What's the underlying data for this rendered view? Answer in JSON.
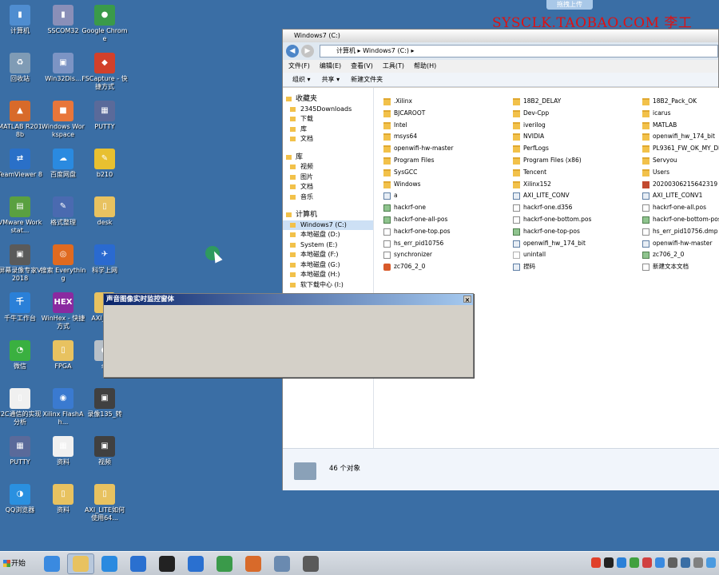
{
  "watermark": "SYSCLK.TAOBAO.COM 李工",
  "upload_button": "拖拽上传",
  "desktop_icons": [
    {
      "label": "计算机",
      "glyph": "▮",
      "color": "#4f8dd0"
    },
    {
      "label": "SSCOM32",
      "glyph": "▮",
      "color": "#8a8fb8"
    },
    {
      "label": "Google Chrome",
      "glyph": "●",
      "color": "#3a9a4a"
    },
    {
      "label": "回收站",
      "glyph": "♻",
      "color": "#7f9bb5"
    },
    {
      "label": "Win32Dis...",
      "glyph": "▣",
      "color": "#7c94c4"
    },
    {
      "label": "FSCapture - 快捷方式",
      "glyph": "◆",
      "color": "#d2402a"
    },
    {
      "label": "MATLAB R2018b",
      "glyph": "▲",
      "color": "#d86a2a"
    },
    {
      "label": "Windows Workspace",
      "glyph": "■",
      "color": "#e8763a"
    },
    {
      "label": "PUTTY",
      "glyph": "▦",
      "color": "#5a6a9a"
    },
    {
      "label": "TeamViewer 8",
      "glyph": "⇄",
      "color": "#2a70c8"
    },
    {
      "label": "百度网盘",
      "glyph": "☁",
      "color": "#2a8ae0"
    },
    {
      "label": "b210",
      "glyph": "✎",
      "color": "#e8c030"
    },
    {
      "label": "VMware Workstat...",
      "glyph": "▤",
      "color": "#5aa040"
    },
    {
      "label": "格式整理",
      "glyph": "✎",
      "color": "#4a6ab0"
    },
    {
      "label": "desk",
      "glyph": "▯",
      "color": "#e8c260"
    },
    {
      "label": "屏幕录像专家V2018",
      "glyph": "▣",
      "color": "#5a5a5a"
    },
    {
      "label": "搜索 Everything",
      "glyph": "◎",
      "color": "#e06a20"
    },
    {
      "label": "科学上网",
      "glyph": "✈",
      "color": "#2a6ad0"
    },
    {
      "label": "千牛工作台",
      "glyph": "千",
      "color": "#2a80d8"
    },
    {
      "label": "WinHex - 快捷方式",
      "glyph": "HEX",
      "color": "#8a2aa0"
    },
    {
      "label": "AXI_接口",
      "glyph": "▯",
      "color": "#e8c260"
    },
    {
      "label": "微信",
      "glyph": "◔",
      "color": "#3ab040"
    },
    {
      "label": "FPGA",
      "glyph": "▯",
      "color": "#e8c260"
    },
    {
      "label": "ss",
      "glyph": "●",
      "color": "#b8c0c8"
    },
    {
      "label": "I2C通信的实现分析",
      "glyph": "▯",
      "color": "#f0f0f0"
    },
    {
      "label": "Xilinx FlashAh...",
      "glyph": "◉",
      "color": "#3a7ad0"
    },
    {
      "label": "录像135_转",
      "glyph": "▣",
      "color": "#404040"
    },
    {
      "label": "PUTTY",
      "glyph": "▦",
      "color": "#5a6a9a"
    },
    {
      "label": "资料",
      "glyph": "▦",
      "color": "#f0f0f0"
    },
    {
      "label": "视频",
      "glyph": "▣",
      "color": "#404040"
    },
    {
      "label": "QQ浏览器",
      "glyph": "◑",
      "color": "#2a90e0"
    },
    {
      "label": "资料",
      "glyph": "▯",
      "color": "#e8c260"
    },
    {
      "label": "AXI_LITE如何使用64...",
      "glyph": "▯",
      "color": "#e8c260"
    }
  ],
  "explorer": {
    "title": "Windows7 (C:)",
    "address": "计算机 ▸ Windows7 (C:) ▸",
    "menu": [
      "文件(F)",
      "编辑(E)",
      "查看(V)",
      "工具(T)",
      "帮助(H)"
    ],
    "toolbar": [
      "组织 ▾",
      "共享 ▾",
      "新建文件夹"
    ],
    "nav": {
      "favorites": {
        "head": "收藏夹",
        "items": [
          "2345Downloads",
          "下载",
          "库",
          "文档"
        ]
      },
      "libraries": {
        "head": "库",
        "items": [
          "视频",
          "图片",
          "文档",
          "音乐"
        ]
      },
      "computer": {
        "head": "计算机",
        "items": [
          "Windows7 (C:)",
          "本地磁盘 (D:)",
          "System (E:)",
          "本地磁盘 (F:)",
          "本地磁盘 (G:)",
          "本地磁盘 (H:)",
          "软下载中心 (I:)"
        ]
      }
    },
    "files": [
      [
        {
          "name": ".Xilinx",
          "type": "folder"
        },
        {
          "name": "BJCAROOT",
          "type": "folder"
        },
        {
          "name": "Intel",
          "type": "folder"
        },
        {
          "name": "msys64",
          "type": "folder"
        },
        {
          "name": "openwifi-hw-master",
          "type": "folder"
        },
        {
          "name": "Program Files",
          "type": "folder"
        },
        {
          "name": "SysGCC",
          "type": "folder"
        },
        {
          "name": "Windows",
          "type": "folder"
        },
        {
          "name": "a",
          "type": "prog"
        },
        {
          "name": "hackrf-one",
          "type": "img"
        },
        {
          "name": "hackrf-one-all-pos",
          "type": "img"
        },
        {
          "name": "hackrf-one-top.pos",
          "type": "doc"
        },
        {
          "name": "hs_err_pid10756",
          "type": "doc"
        },
        {
          "name": "synchronizer",
          "type": "doc"
        },
        {
          "name": "zc706_2_0",
          "type": "app"
        },
        {
          "name": "AXI_LITE_CONV",
          "type": "folder"
        }
      ],
      [
        {
          "name": "18B2_DELAY",
          "type": "folder"
        },
        {
          "name": "Dev-Cpp",
          "type": "folder"
        },
        {
          "name": "iverilog",
          "type": "folder"
        },
        {
          "name": "NVIDIA",
          "type": "folder"
        },
        {
          "name": "PerfLogs",
          "type": "folder"
        },
        {
          "name": "Program Files (x86)",
          "type": "folder"
        },
        {
          "name": "Tencent",
          "type": "folder"
        },
        {
          "name": "Xilinx152",
          "type": "folder"
        },
        {
          "name": "AXI_LITE_CONV",
          "type": "prog"
        },
        {
          "name": "hackrf-one.d356",
          "type": "doc"
        },
        {
          "name": "hackrf-one-bottom.pos",
          "type": "doc"
        },
        {
          "name": "hackrf-one-top-pos",
          "type": "img"
        },
        {
          "name": "openwifi_hw_174_bit",
          "type": "prog"
        },
        {
          "name": "unintall",
          "type": "blank"
        },
        {
          "name": "捏码",
          "type": "prog"
        }
      ],
      [
        {
          "name": "18B2_Pack_OK",
          "type": "folder"
        },
        {
          "name": "icarus",
          "type": "folder"
        },
        {
          "name": "MATLAB",
          "type": "folder"
        },
        {
          "name": "openwifi_hw_174_bit",
          "type": "folder"
        },
        {
          "name": "PL9361_FW_OK_MY_DDS_",
          "type": "folder"
        },
        {
          "name": "Servyou",
          "type": "folder"
        },
        {
          "name": "Users",
          "type": "folder"
        },
        {
          "name": "20200306215642319",
          "type": "red"
        },
        {
          "name": "AXI_LITE_CONV1",
          "type": "prog"
        },
        {
          "name": "hackrf-one-all.pos",
          "type": "doc"
        },
        {
          "name": "hackrf-one-bottom-pos",
          "type": "img"
        },
        {
          "name": "hs_err_pid10756.dmp",
          "type": "doc"
        },
        {
          "name": "openwifi-hw-master",
          "type": "prog"
        },
        {
          "name": "zc706_2_0",
          "type": "img"
        },
        {
          "name": "新建文本文档",
          "type": "doc"
        }
      ]
    ],
    "status": "46 个对象"
  },
  "dialog": {
    "title": "声音图像实时监控窗体",
    "close": "×"
  },
  "taskbar": {
    "start": "开始",
    "items": [
      {
        "name": "ie",
        "color": "#3a8ae0"
      },
      {
        "name": "explorer",
        "color": "#e8c260"
      },
      {
        "name": "baidu-netdisk",
        "color": "#2a8ae0"
      },
      {
        "name": "notes",
        "color": "#2a70d0"
      },
      {
        "name": "qq",
        "color": "#222222"
      },
      {
        "name": "sogou",
        "color": "#2a70d0"
      },
      {
        "name": "chrome",
        "color": "#3a9a4a"
      },
      {
        "name": "matlab",
        "color": "#d86a2a"
      },
      {
        "name": "app-window",
        "color": "#6a8ab0"
      },
      {
        "name": "monitor-app",
        "color": "#5a5a5a"
      }
    ],
    "tray_colors": [
      "#e0402a",
      "#222222",
      "#2a80d8",
      "#40a040",
      "#d04040",
      "#3a8ae0",
      "#606060",
      "#3a6ea5",
      "#808080",
      "#4a9ae0"
    ]
  }
}
